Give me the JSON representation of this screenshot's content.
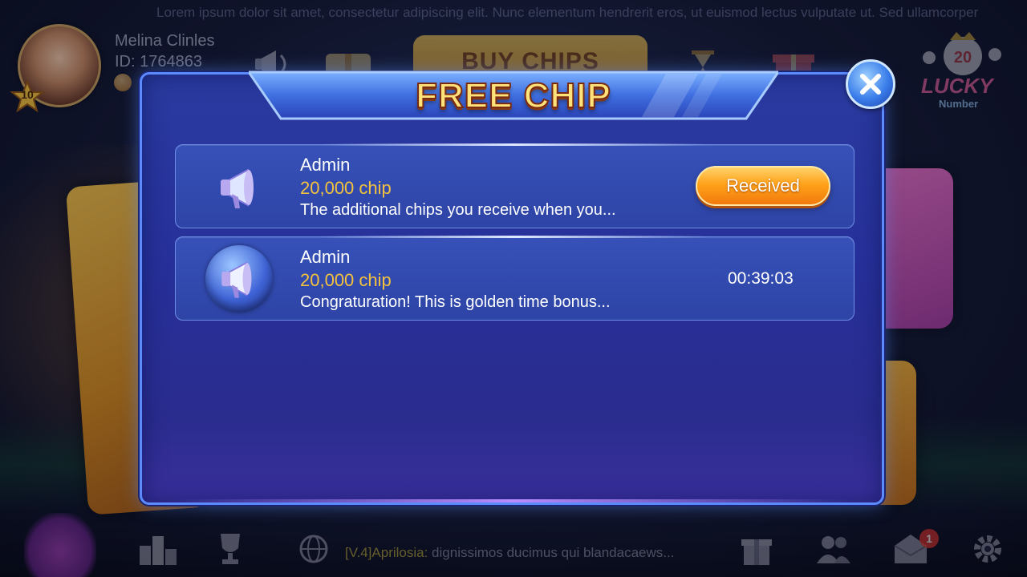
{
  "background": {
    "ticker_top": "Lorem ipsum dolor sit amet, consectetur adipiscing elit. Nunc elementum hendrerit eros, ut euismod lectus vulputate ut. Sed ullamcorper",
    "player": {
      "name": "Melina Clinles",
      "id": "ID: 1764863",
      "level": "10"
    },
    "buy_chips_label": "BUY CHIPS",
    "gift_code_label": "GIFT CODE",
    "lucky_label": "LUCKY",
    "lucky_sub": "Number",
    "lucky_ball": "20",
    "bottom_ticker": {
      "user": "[V.4]Aprilosia:",
      "message": " dignissimos ducimus qui blandacaews..."
    },
    "mail_badge": "1"
  },
  "modal": {
    "title": "FREE CHIP",
    "messages": [
      {
        "sender": "Admin",
        "amount": "20,000 chip",
        "text": "The additional chips you receive when you...",
        "action_label": "Received",
        "icon": "megaphone-icon"
      },
      {
        "sender": "Admin",
        "amount": "20,000 chip",
        "text": "Congraturation! This is golden time bonus...",
        "timer": "00:39:03",
        "icon": "megaphone-orb-icon"
      }
    ]
  },
  "colors": {
    "modal_bg": "#2a3ba0",
    "modal_border": "#5b8bff",
    "amount_gold": "#f4c23c",
    "received_orange": "#ffa21a",
    "title_gold": "#ffe27a"
  }
}
